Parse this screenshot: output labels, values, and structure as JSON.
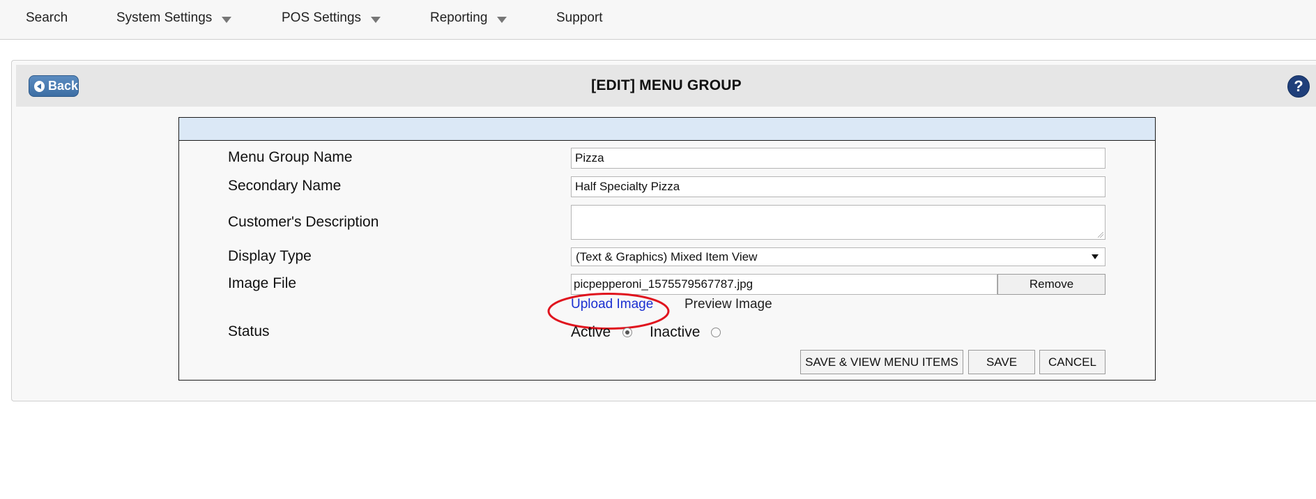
{
  "nav": {
    "items": [
      {
        "label": "Search",
        "has_dropdown": false
      },
      {
        "label": "System Settings",
        "has_dropdown": true
      },
      {
        "label": "POS Settings",
        "has_dropdown": true
      },
      {
        "label": "Reporting",
        "has_dropdown": true
      },
      {
        "label": "Support",
        "has_dropdown": false
      }
    ]
  },
  "header": {
    "back_label": "Back",
    "title": "[EDIT] MENU GROUP",
    "help_label": "?"
  },
  "form": {
    "menu_group_name": {
      "label": "Menu Group Name",
      "value": "Pizza"
    },
    "secondary_name": {
      "label": "Secondary Name",
      "value": "Half Specialty Pizza"
    },
    "customer_description": {
      "label": "Customer's Description",
      "value": ""
    },
    "display_type": {
      "label": "Display Type",
      "selected": "(Text & Graphics) Mixed Item View"
    },
    "image_file": {
      "label": "Image File",
      "value": "picpepperoni_1575579567787.jpg",
      "remove_label": "Remove",
      "upload_label": "Upload Image",
      "preview_label": "Preview Image"
    },
    "status": {
      "label": "Status",
      "options": [
        {
          "label": "Active",
          "checked": true
        },
        {
          "label": "Inactive",
          "checked": false
        }
      ]
    }
  },
  "actions": {
    "save_view_label": "SAVE & VIEW MENU ITEMS",
    "save_label": "SAVE",
    "cancel_label": "CANCEL"
  },
  "colors": {
    "nav_bg": "#f7f7f7",
    "header_bg": "#e6e6e6",
    "form_header_bg": "#dbe8f6",
    "back_button": "#3d6ea4",
    "help_button": "#1f3f7a",
    "link": "#1a2fd1",
    "annotation": "#e0141e"
  },
  "annotation": {
    "shape": "ellipse",
    "target": "upload-image-link"
  }
}
